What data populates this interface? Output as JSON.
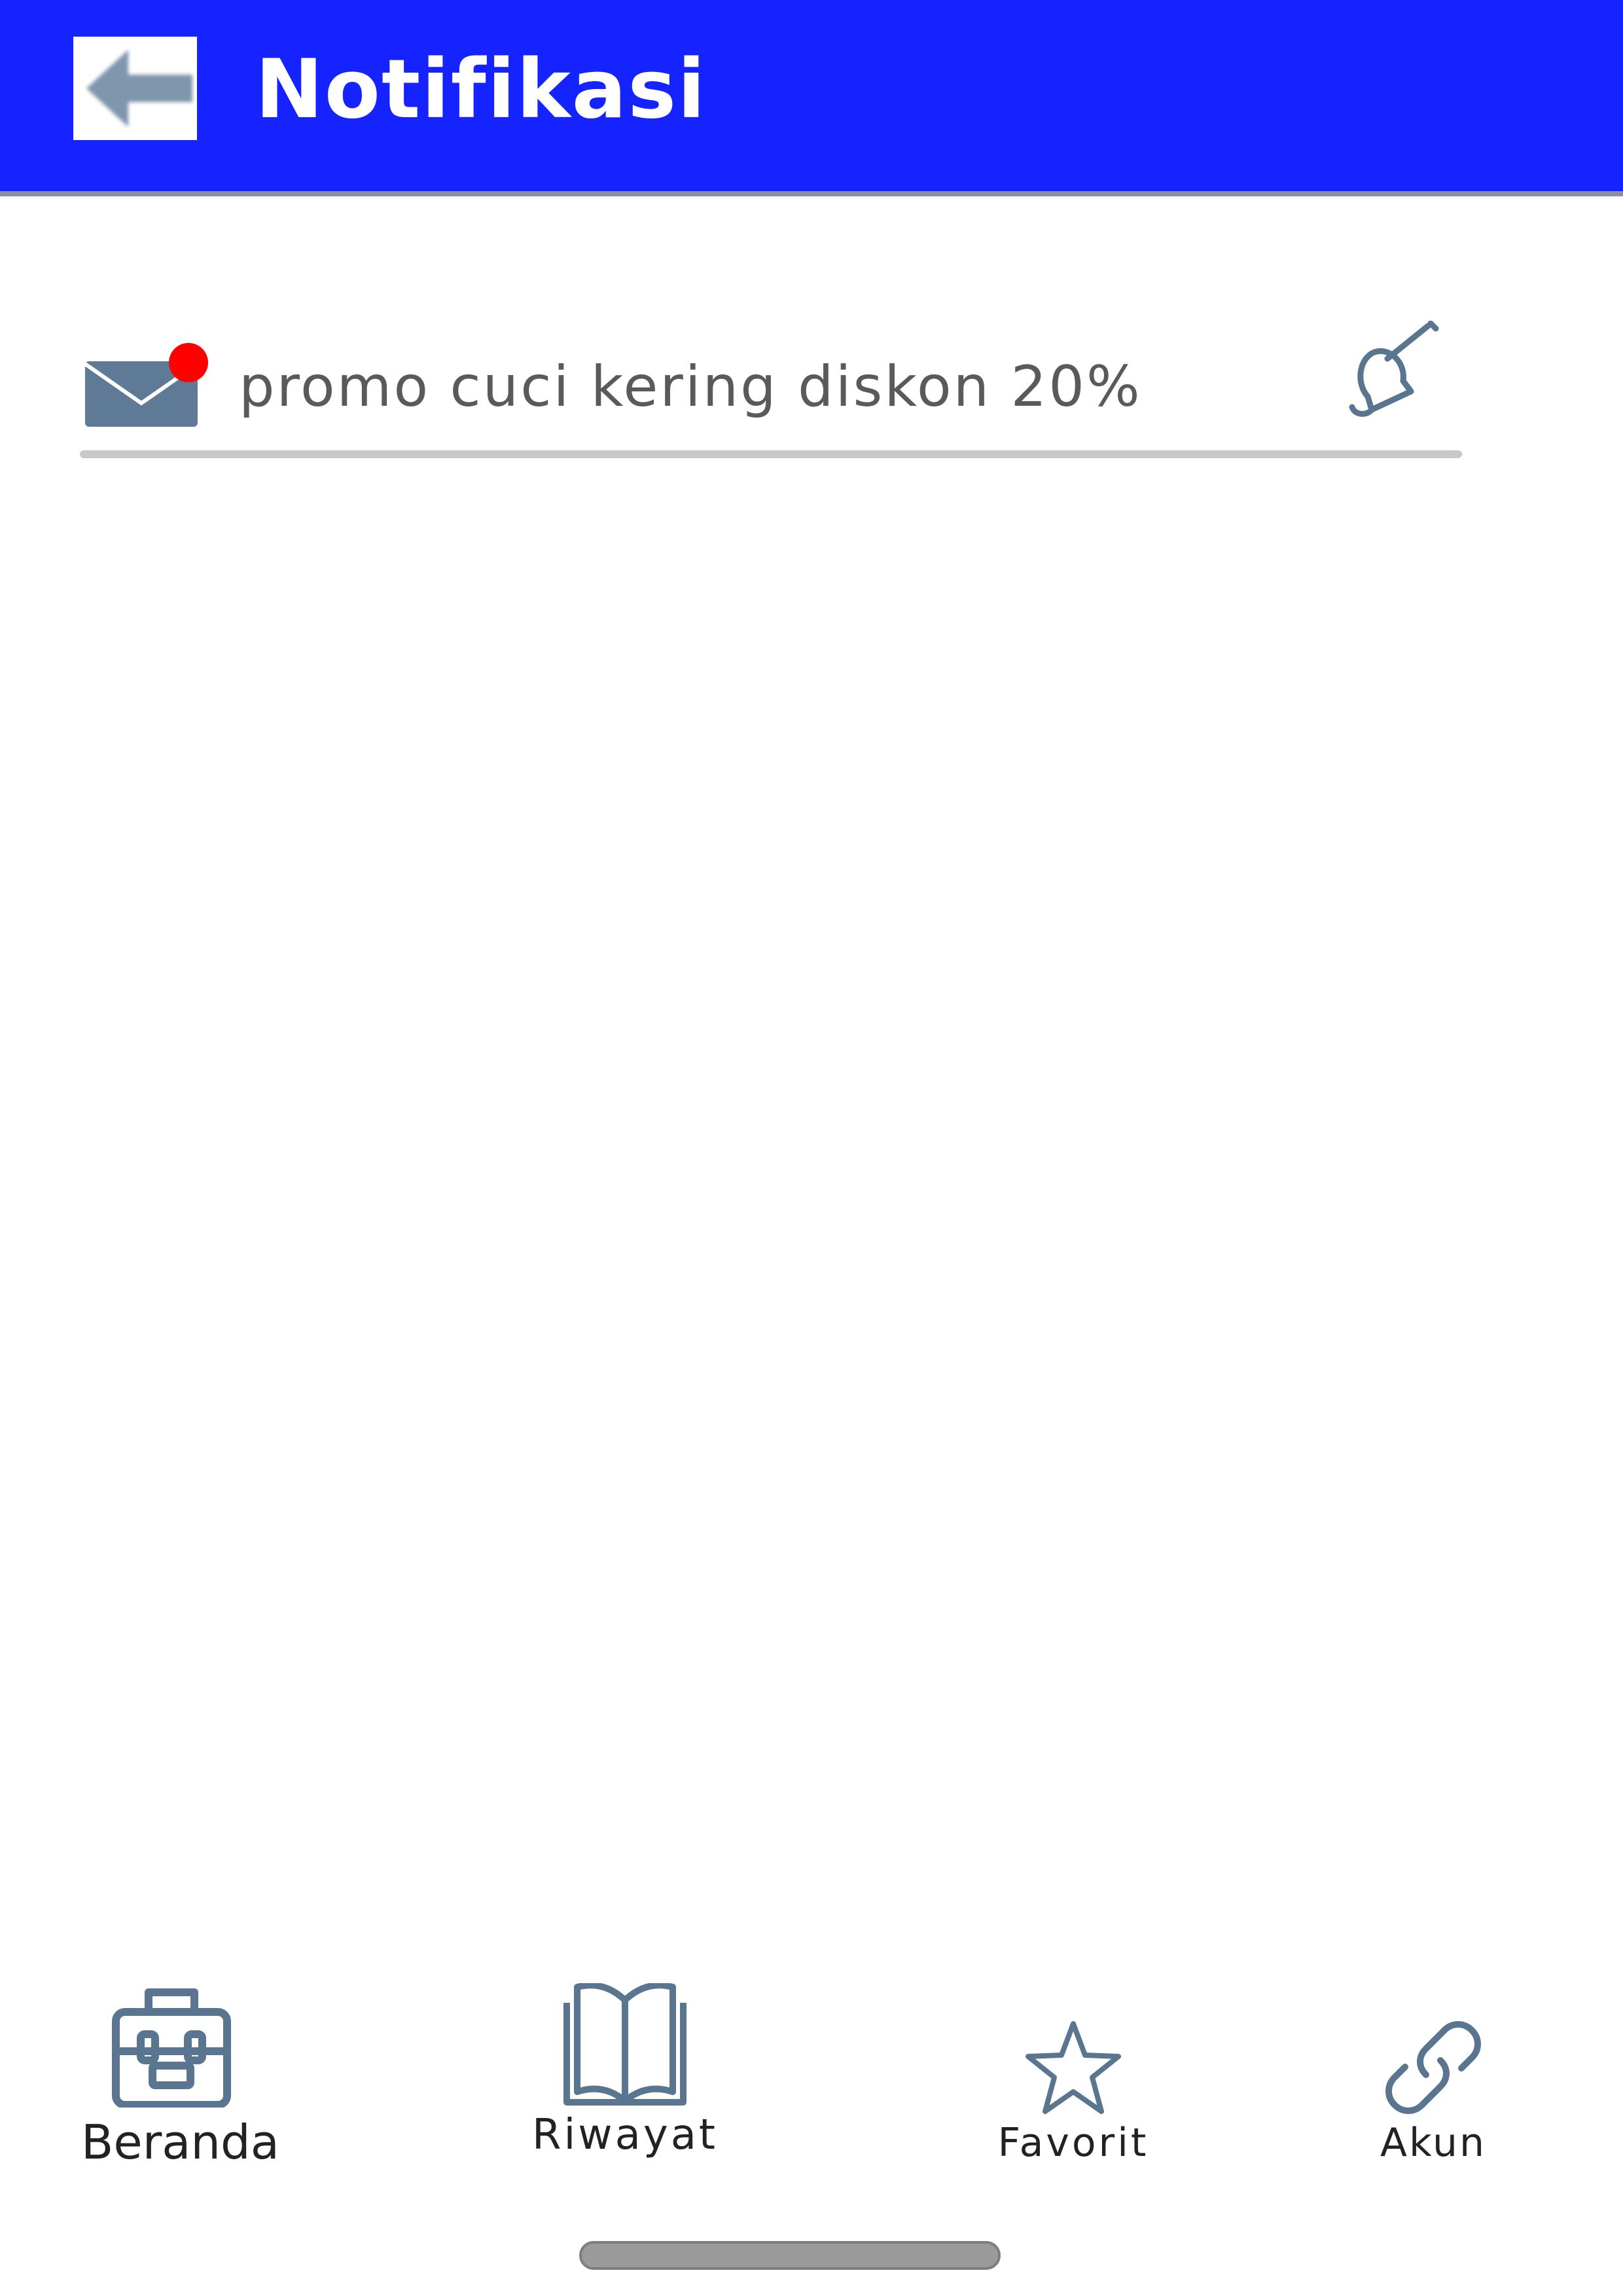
{
  "header": {
    "title": "Notifikasi",
    "back_icon": "arrow-left-icon",
    "background_color": "#1423ff"
  },
  "notifications": [
    {
      "icon": "mail-icon",
      "unread": true,
      "text": "promo cuci kering diskon 20%",
      "action_icon": "bell-icon"
    }
  ],
  "bottom_nav": {
    "items": [
      {
        "label": "Beranda",
        "icon": "briefcase-icon"
      },
      {
        "label": "Riwayat",
        "icon": "book-icon"
      },
      {
        "label": "Favorit",
        "icon": "star-icon"
      },
      {
        "label": "Akun",
        "icon": "link-icon"
      }
    ]
  },
  "colors": {
    "accent": "#1423ff",
    "icon": "#5a7590",
    "unread_dot": "#ff0000"
  }
}
